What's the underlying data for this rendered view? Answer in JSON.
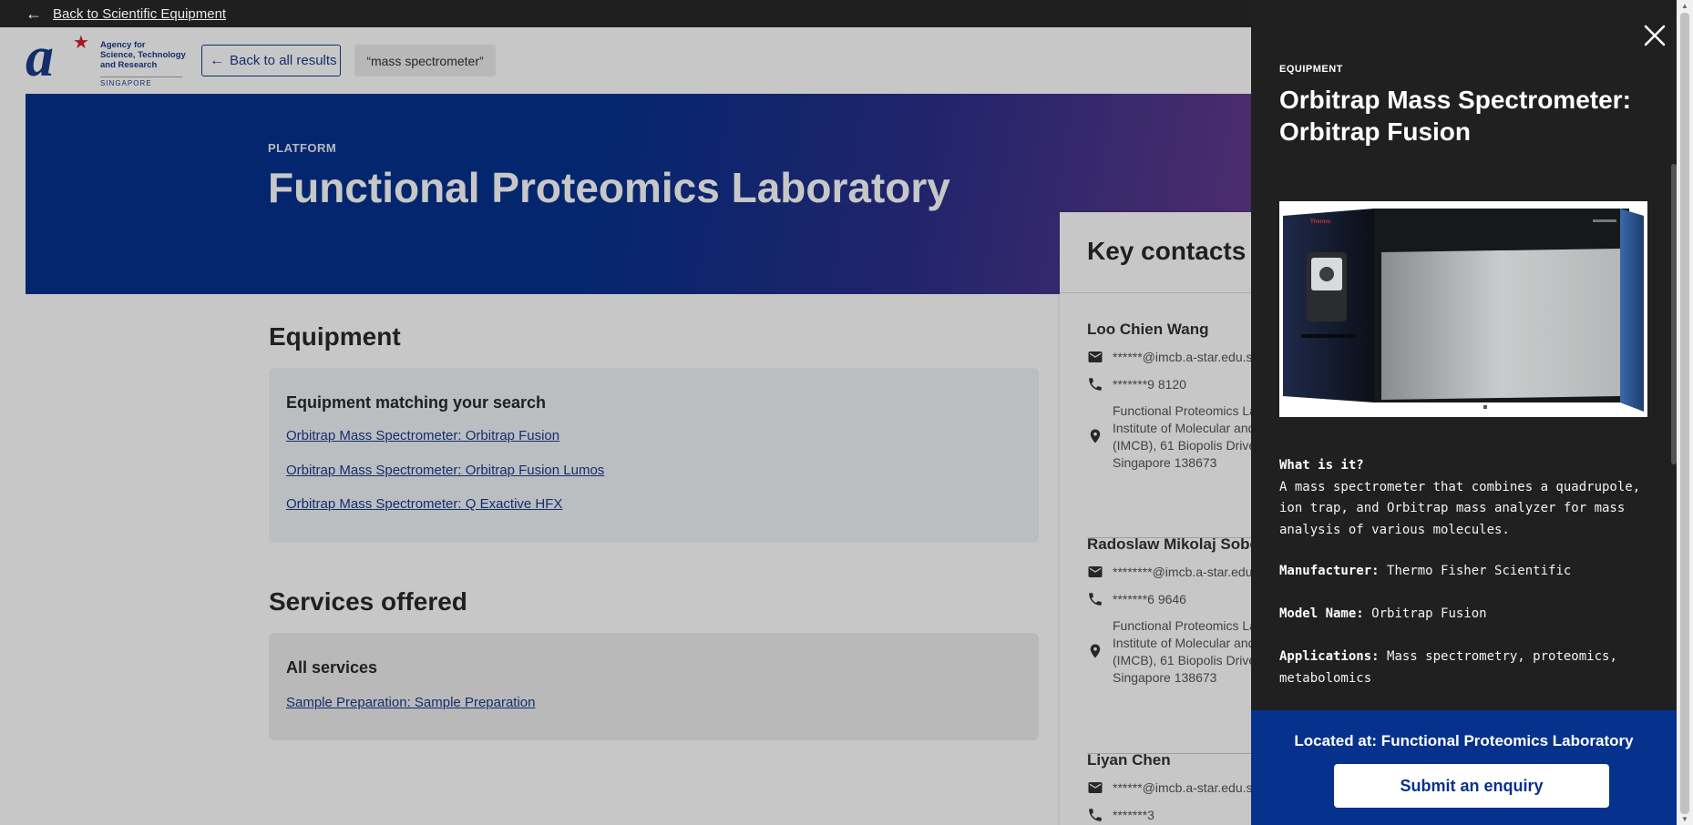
{
  "topbar": {
    "back_label": "Back to Scientific Equipment"
  },
  "header": {
    "logo": {
      "org_line1": "Agency for",
      "org_line2": "Science, Technology",
      "org_line3": "and Research",
      "country": "SINGAPORE"
    },
    "back_all_label": "Back to all results",
    "search_chip": "“mass spectrometer”"
  },
  "hero": {
    "kicker": "PLATFORM",
    "title": "Functional Proteomics Laboratory"
  },
  "equipment": {
    "heading": "Equipment",
    "card_heading": "Equipment matching your search",
    "items": [
      "Orbitrap Mass Spectrometer: Orbitrap Fusion",
      "Orbitrap Mass Spectrometer: Orbitrap Fusion Lumos",
      "Orbitrap Mass Spectrometer: Q Exactive HFX"
    ]
  },
  "services": {
    "heading": "Services offered",
    "card_heading": "All services",
    "items": [
      "Sample Preparation: Sample Preparation"
    ]
  },
  "contacts": {
    "heading": "Key contacts",
    "people": [
      {
        "name": "Loo Chien Wang",
        "email": "******@imcb.a-star.edu.sg",
        "phone": "*******9 8120",
        "address": "Functional Proteomics Laboratory, Institute of Molecular and Cell Biology (IMCB), 61 Biopolis Drive, Proteos, Singapore 138673"
      },
      {
        "name": "Radoslaw Mikolaj Sobota",
        "email": "********@imcb.a-star.edu.sg",
        "phone": "*******6 9646",
        "address": "Functional Proteomics Laboratory, Institute of Molecular and Cell Biology (IMCB), 61 Biopolis Drive, Proteos, Singapore 138673"
      },
      {
        "name": "Liyan Chen",
        "email": "******@imcb.a-star.edu.sg",
        "phone": "*******3"
      }
    ]
  },
  "panel": {
    "kicker": "EQUIPMENT",
    "title": "Orbitrap Mass Spectrometer: Orbitrap Fusion",
    "what_label": "What is it?",
    "what_text": "A mass spectrometer that combines a quadrupole, ion trap, and Orbitrap mass analyzer for mass analysis of various molecules.",
    "manufacturer_label": "Manufacturer:",
    "manufacturer": "Thermo Fisher Scientific",
    "model_label": "Model Name:",
    "model": "Orbitrap Fusion",
    "applications_label": "Applications:",
    "applications": "Mass spectrometry, proteomics, metabolomics",
    "image_brand": "Thermo",
    "located_at": "Located at: Functional Proteomics Laboratory",
    "enquiry_label": "Submit an enquiry"
  },
  "icons": [
    "arrow-left-icon",
    "close-icon",
    "mail-icon",
    "phone-icon",
    "location-pin-icon"
  ],
  "colors": {
    "brand_blue": "#06318d",
    "panel_bg": "#202020",
    "link": "#1a3a8a"
  }
}
